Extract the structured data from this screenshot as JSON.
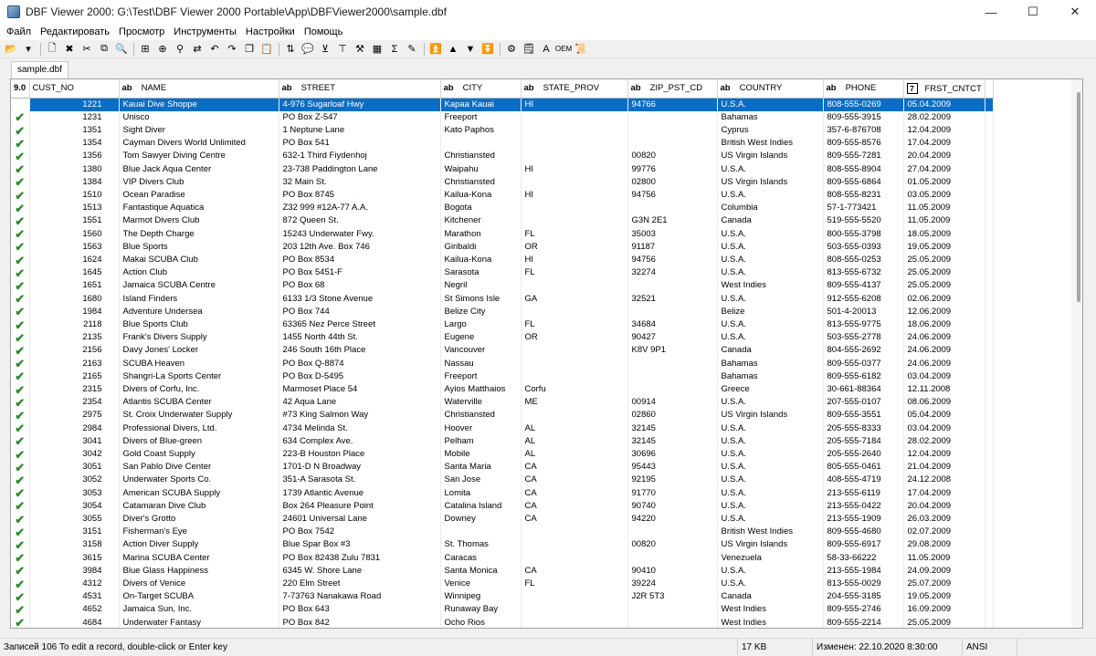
{
  "window": {
    "title": "DBF Viewer 2000: G:\\Test\\DBF Viewer 2000 Portable\\App\\DBFViewer2000\\sample.dbf",
    "minimize_glyph": "—",
    "maximize_glyph": "☐",
    "close_glyph": "✕"
  },
  "menu": [
    "Файл",
    "Редактировать",
    "Просмотр",
    "Инструменты",
    "Настройки",
    "Помощь"
  ],
  "toolbar": {
    "icons": [
      {
        "name": "open-folder-icon",
        "glyph": "📂"
      },
      {
        "name": "dropdown-arrow-icon",
        "glyph": "▾"
      },
      {
        "name": "new-file-icon",
        "glyph": "🗋"
      },
      {
        "name": "delete-icon",
        "glyph": "✖"
      },
      {
        "name": "cut-icon",
        "glyph": "✂"
      },
      {
        "name": "copy-record-icon",
        "glyph": "⧉"
      },
      {
        "name": "find-icon",
        "glyph": "🔍"
      },
      {
        "name": "insert-record-icon",
        "glyph": "⊞"
      },
      {
        "name": "append-icon",
        "glyph": "⊕"
      },
      {
        "name": "find-replace-icon",
        "glyph": "⚲"
      },
      {
        "name": "replace-icon",
        "glyph": "⇄"
      },
      {
        "name": "undo-icon",
        "glyph": "↶"
      },
      {
        "name": "redo-icon",
        "glyph": "↷"
      },
      {
        "name": "copy-icon",
        "glyph": "❐"
      },
      {
        "name": "paste-icon",
        "glyph": "📋"
      },
      {
        "name": "sort-icon",
        "glyph": "⇅"
      },
      {
        "name": "comment-icon",
        "glyph": "💬"
      },
      {
        "name": "filter-icon",
        "glyph": "⊻"
      },
      {
        "name": "structure-icon",
        "glyph": "⊤"
      },
      {
        "name": "tools-icon",
        "glyph": "⚒"
      },
      {
        "name": "grid-icon",
        "glyph": "▦"
      },
      {
        "name": "sum-icon",
        "glyph": "Σ"
      },
      {
        "name": "brush-icon",
        "glyph": "✎"
      },
      {
        "name": "first-record-icon",
        "glyph": "⏫"
      },
      {
        "name": "prev-record-icon",
        "glyph": "▲"
      },
      {
        "name": "next-record-icon",
        "glyph": "▼"
      },
      {
        "name": "last-record-icon",
        "glyph": "⏬"
      },
      {
        "name": "settings-icon",
        "glyph": "⚙"
      },
      {
        "name": "note-icon",
        "glyph": "🗒"
      },
      {
        "name": "font-icon",
        "glyph": "A"
      },
      {
        "name": "oem-icon",
        "glyph": "OEM"
      },
      {
        "name": "script-icon",
        "glyph": "📜"
      }
    ]
  },
  "tab": {
    "label": "sample.dbf"
  },
  "grid": {
    "version": "9.0",
    "columns": [
      {
        "key": "cust_no",
        "label": "CUST_NO",
        "type": ""
      },
      {
        "key": "name",
        "label": "NAME",
        "type": "ab"
      },
      {
        "key": "street",
        "label": "STREET",
        "type": "ab"
      },
      {
        "key": "city",
        "label": "CITY",
        "type": "ab"
      },
      {
        "key": "state",
        "label": "STATE_PROV",
        "type": "ab"
      },
      {
        "key": "zip",
        "label": "ZIP_PST_CD",
        "type": "ab"
      },
      {
        "key": "country",
        "label": "COUNTRY",
        "type": "ab"
      },
      {
        "key": "phone",
        "label": "PHONE",
        "type": "ab"
      },
      {
        "key": "contact",
        "label": "FRST_CNTCT",
        "type": "7"
      }
    ],
    "selected_row": 0,
    "rows": [
      [
        "1221",
        "Kauai Dive Shoppe",
        "4-976 Sugarloaf Hwy",
        "Kapaa Kauai",
        "HI",
        "94766",
        "U.S.A.",
        "808-555-0269",
        "05.04.2009"
      ],
      [
        "1231",
        "Unisco",
        "PO Box Z-547",
        "Freeport",
        "",
        "",
        "Bahamas",
        "809-555-3915",
        "28.02.2009"
      ],
      [
        "1351",
        "Sight Diver",
        "1 Neptune Lane",
        "Kato Paphos",
        "",
        "",
        "Cyprus",
        "357-6-876708",
        "12.04.2009"
      ],
      [
        "1354",
        "Cayman Divers World Unlimited",
        "PO Box 541",
        "",
        "",
        "",
        "British West Indies",
        "809-555-8576",
        "17.04.2009"
      ],
      [
        "1356",
        "Tom Sawyer Diving Centre",
        "632-1 Third Fiydenhoj",
        "Christiansted",
        "",
        "00820",
        "US Virgin Islands",
        "809-555-7281",
        "20.04.2009"
      ],
      [
        "1380",
        "Blue Jack Aqua Center",
        "23-738 Paddington Lane",
        "Waipahu",
        "HI",
        "99776",
        "U.S.A.",
        "808-555-8904",
        "27.04.2009"
      ],
      [
        "1384",
        "VIP Divers Club",
        "32 Main St.",
        "Christiansted",
        "",
        "02800",
        "US Virgin Islands",
        "809-555-6864",
        "01.05.2009"
      ],
      [
        "1510",
        "Ocean Paradise",
        "PO Box 8745",
        "Kailua-Kona",
        "HI",
        "94756",
        "U.S.A.",
        "808-555-8231",
        "03.05.2009"
      ],
      [
        "1513",
        "Fantastique Aquatica",
        "Z32 999 #12A-77 A.A.",
        "Bogota",
        "",
        "",
        "Columbia",
        "57-1-773421",
        "11.05.2009"
      ],
      [
        "1551",
        "Marmot Divers Club",
        "872 Queen St.",
        "Kitchener",
        "",
        "G3N 2E1",
        "Canada",
        "519-555-5520",
        "11.05.2009"
      ],
      [
        "1560",
        "The Depth Charge",
        "15243 Underwater Fwy.",
        "Marathon",
        "FL",
        "35003",
        "U.S.A.",
        "800-555-3798",
        "18.05.2009"
      ],
      [
        "1563",
        "Blue Sports",
        "203 12th Ave. Box 746",
        "Giribaldi",
        "OR",
        "91187",
        "U.S.A.",
        "503-555-0393",
        "19.05.2009"
      ],
      [
        "1624",
        "Makai SCUBA Club",
        "PO Box 8534",
        "Kailua-Kona",
        "HI",
        "94756",
        "U.S.A.",
        "808-555-0253",
        "25.05.2009"
      ],
      [
        "1645",
        "Action Club",
        "PO Box 5451-F",
        "Sarasota",
        "FL",
        "32274",
        "U.S.A.",
        "813-555-6732",
        "25.05.2009"
      ],
      [
        "1651",
        "Jamaica SCUBA Centre",
        "PO Box 68",
        "Negril",
        "",
        "",
        "West Indies",
        "809-555-4137",
        "25.05.2009"
      ],
      [
        "1680",
        "Island Finders",
        "6133 1/3 Stone Avenue",
        "St Simons Isle",
        "GA",
        "32521",
        "U.S.A.",
        "912-555-6208",
        "02.06.2009"
      ],
      [
        "1984",
        "Adventure Undersea",
        "PO Box 744",
        "Belize City",
        "",
        "",
        "Belize",
        "501-4-20013",
        "12.06.2009"
      ],
      [
        "2118",
        "Blue Sports Club",
        "63365 Nez Perce Street",
        "Largo",
        "FL",
        "34684",
        "U.S.A.",
        "813-555-9775",
        "18.06.2009"
      ],
      [
        "2135",
        "Frank's Divers Supply",
        "1455 North 44th St.",
        "Eugene",
        "OR",
        "90427",
        "U.S.A.",
        "503-555-2778",
        "24.06.2009"
      ],
      [
        "2156",
        "Davy Jones' Locker",
        "246 South 16th Place",
        "Vancouver",
        "",
        "K8V 9P1",
        "Canada",
        "804-555-2692",
        "24.06.2009"
      ],
      [
        "2163",
        "SCUBA Heaven",
        "PO Box Q-8874",
        "Nassau",
        "",
        "",
        "Bahamas",
        "809-555-0377",
        "24.06.2009"
      ],
      [
        "2165",
        "Shangri-La Sports Center",
        "PO Box D-5495",
        "Freeport",
        "",
        "",
        "Bahamas",
        "809-555-6182",
        "03.04.2009"
      ],
      [
        "2315",
        "Divers of Corfu, Inc.",
        "Marmoset Place 54",
        "Ayios Matthaios",
        "Corfu",
        "",
        "Greece",
        "30-661-88364",
        "12.11.2008"
      ],
      [
        "2354",
        "Atlantis SCUBA Center",
        "42 Aqua Lane",
        "Waterville",
        "ME",
        "00914",
        "U.S.A.",
        "207-555-0107",
        "08.06.2009"
      ],
      [
        "2975",
        "St. Croix Underwater Supply",
        "#73 King Salmon Way",
        "Christiansted",
        "",
        "02860",
        "US Virgin Islands",
        "809-555-3551",
        "05.04.2009"
      ],
      [
        "2984",
        "Professional Divers, Ltd.",
        "4734 Melinda St.",
        "Hoover",
        "AL",
        "32145",
        "U.S.A.",
        "205-555-8333",
        "03.04.2009"
      ],
      [
        "3041",
        "Divers of Blue-green",
        "634 Complex Ave.",
        "Pelham",
        "AL",
        "32145",
        "U.S.A.",
        "205-555-7184",
        "28.02.2009"
      ],
      [
        "3042",
        "Gold Coast Supply",
        "223-B Houston Place",
        "Mobile",
        "AL",
        "30696",
        "U.S.A.",
        "205-555-2640",
        "12.04.2009"
      ],
      [
        "3051",
        "San Pablo Dive Center",
        "1701-D N Broadway",
        "Santa Maria",
        "CA",
        "95443",
        "U.S.A.",
        "805-555-0461",
        "21.04.2009"
      ],
      [
        "3052",
        "Underwater Sports Co.",
        "351-A Sarasota St.",
        "San Jose",
        "CA",
        "92195",
        "U.S.A.",
        "408-555-4719",
        "24.12.2008"
      ],
      [
        "3053",
        "American SCUBA Supply",
        "1739 Atlantic Avenue",
        "Lomita",
        "CA",
        "91770",
        "U.S.A.",
        "213-555-6119",
        "17.04.2009"
      ],
      [
        "3054",
        "Catamaran Dive Club",
        "Box 264 Pleasure Point",
        "Catalina Island",
        "CA",
        "90740",
        "U.S.A.",
        "213-555-0422",
        "20.04.2009"
      ],
      [
        "3055",
        "Diver's Grotto",
        "24601 Universal Lane",
        "Downey",
        "CA",
        "94220",
        "U.S.A.",
        "213-555-1909",
        "26.03.2009"
      ],
      [
        "3151",
        "Fisherman's Eye",
        "PO Box 7542",
        "",
        "",
        "",
        "British West Indies",
        "809-555-4680",
        "02.07.2009"
      ],
      [
        "3158",
        "Action Diver Supply",
        "Blue Spar Box #3",
        "St. Thomas",
        "",
        "00820",
        "US Virgin Islands",
        "809-555-6917",
        "29.08.2009"
      ],
      [
        "3615",
        "Marina SCUBA Center",
        "PO Box 82438 Zulu 7831",
        "Caracas",
        "",
        "",
        "Venezuela",
        "58-33-66222",
        "11.05.2009"
      ],
      [
        "3984",
        "Blue Glass Happiness",
        "6345 W. Shore Lane",
        "Santa Monica",
        "CA",
        "90410",
        "U.S.A.",
        "213-555-1984",
        "24.09.2009"
      ],
      [
        "4312",
        "Divers of Venice",
        "220 Elm Street",
        "Venice",
        "FL",
        "39224",
        "U.S.A.",
        "813-555-0029",
        "25.07.2009"
      ],
      [
        "4531",
        "On-Target SCUBA",
        "7-73763 Nanakawa Road",
        "Winnipeg",
        "",
        "J2R 5T3",
        "Canada",
        "204-555-3185",
        "19.05.2009"
      ],
      [
        "4652",
        "Jamaica Sun, Inc.",
        "PO Box 643",
        "Runaway Bay",
        "",
        "",
        "West Indies",
        "809-555-2746",
        "16.09.2009"
      ],
      [
        "4684",
        "Underwater Fantasy",
        "PO Box 842",
        "Ocho Rios",
        "",
        "",
        "West Indies",
        "809-555-2214",
        "25.05.2009"
      ]
    ]
  },
  "status": {
    "records": "Записей 106 To edit a record, double-click or Enter key",
    "size": "17 KB",
    "modified": "Изменен: 22.10.2020 8:30:00",
    "encoding": "ANSI"
  }
}
